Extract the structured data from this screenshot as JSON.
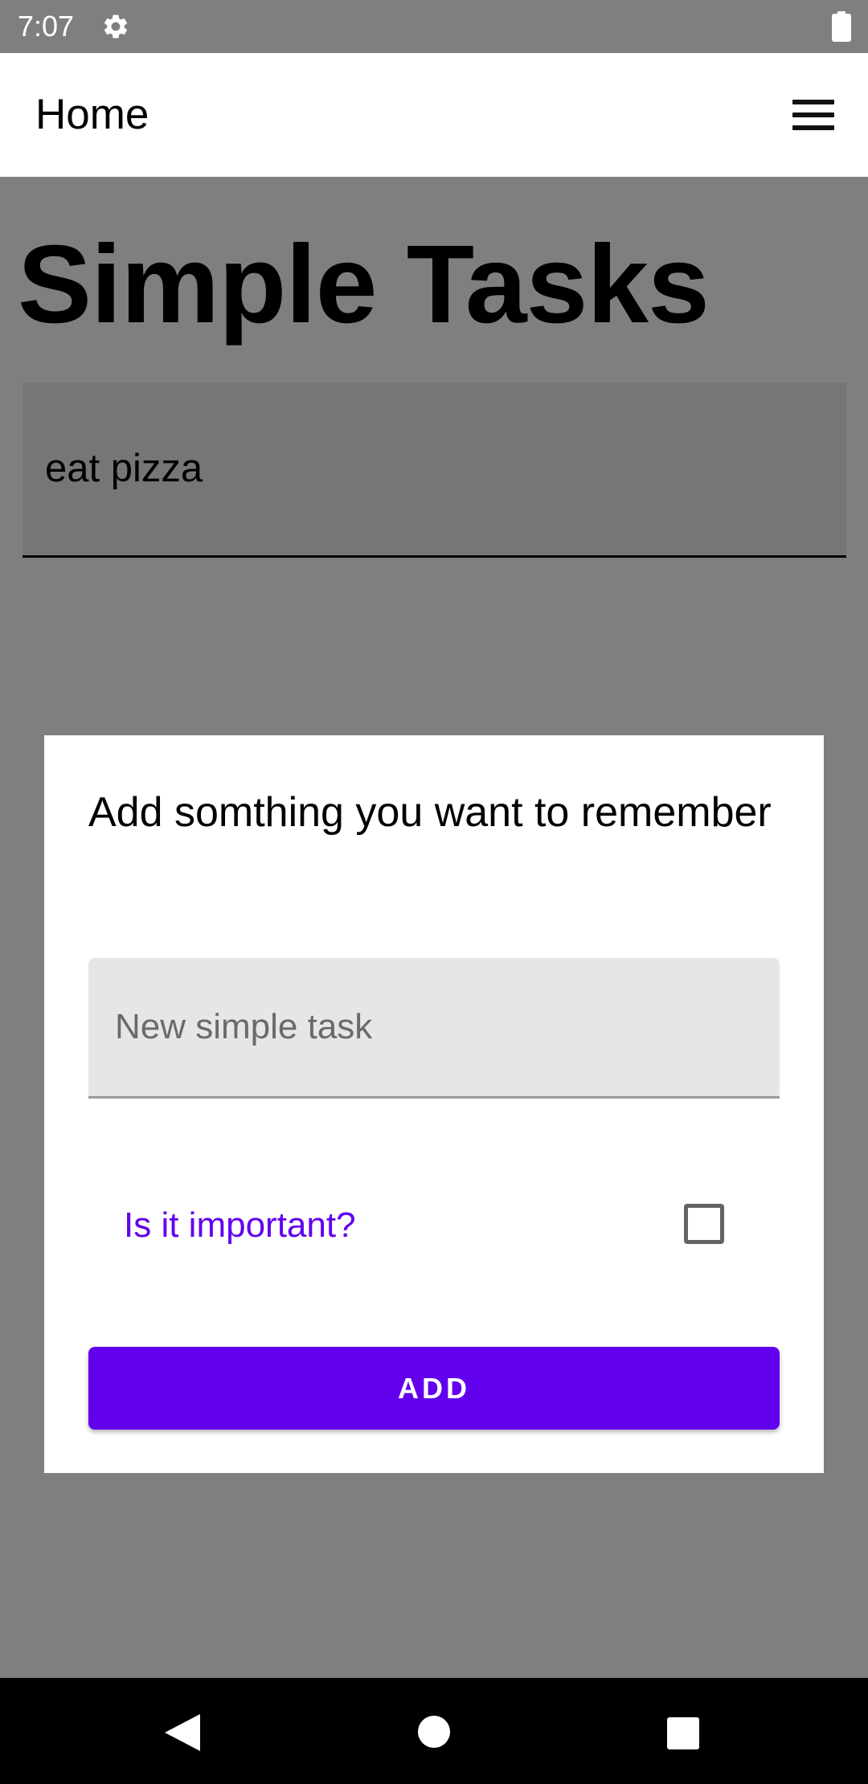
{
  "status_bar": {
    "time": "7:07",
    "icons": [
      "gear-icon",
      "battery-icon"
    ]
  },
  "app_bar": {
    "title": "Home",
    "menu_icon": "hamburger-menu-icon"
  },
  "page": {
    "heading": "Simple Tasks",
    "tasks": [
      {
        "text": "eat pizza"
      }
    ]
  },
  "dialog": {
    "title": "Add somthing you want to remember",
    "task_field": {
      "value": "",
      "placeholder": "New simple task"
    },
    "important": {
      "label": "Is it important?",
      "checked": false
    },
    "add_button_label": "ADD"
  },
  "nav_bar": {
    "icons": [
      "back-icon",
      "home-icon",
      "recents-icon"
    ]
  },
  "colors": {
    "accent": "#6200ee",
    "scrim": "#7f7f7f",
    "surface": "#ffffff",
    "navbar": "#000000"
  }
}
